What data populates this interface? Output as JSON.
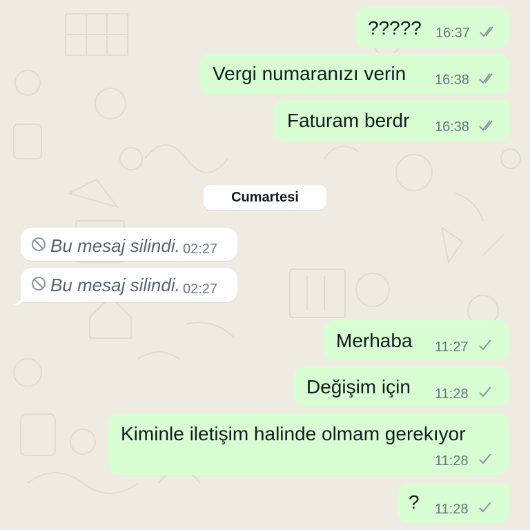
{
  "chat": {
    "date_separator": "Cumartesi",
    "messages_before": [
      {
        "text": "?????",
        "time": "16:37"
      },
      {
        "text": "Vergi numaranızı verin",
        "time": "16:38"
      },
      {
        "text": "Faturam berdr",
        "time": "16:38"
      }
    ],
    "deleted_messages": [
      {
        "text": "Bu mesaj silindi.",
        "time": "02:27"
      },
      {
        "text": "Bu mesaj silindi.",
        "time": "02:27"
      }
    ],
    "messages_after": [
      {
        "text": "Merhaba",
        "time": "11:27"
      },
      {
        "text": "Değişim için",
        "time": "11:28"
      },
      {
        "text": "Kiminle iletişim halinde olmam gerekıyor",
        "time": "11:28"
      },
      {
        "text": "?",
        "time": "11:28"
      }
    ]
  },
  "icons": {
    "double_check": "double-check-icon",
    "single_check": "single-check-icon",
    "deleted": "prohibited-icon"
  },
  "colors": {
    "outgoing_bubble": "#d9fdd3",
    "incoming_bubble": "#ffffff",
    "wallpaper": "#efeae2",
    "meta_text": "#667781"
  }
}
